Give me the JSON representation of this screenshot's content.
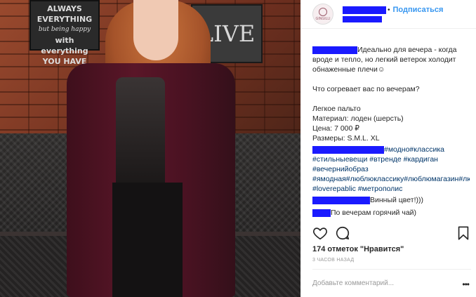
{
  "photo": {
    "sign_left": {
      "line1": "ALWAYS",
      "line2": "EVERYTHING",
      "line3": "but being happy",
      "line4": "with everything",
      "line5": "YOU HAVE"
    },
    "sign_right": "LIVE"
  },
  "header": {
    "avatar_text": "GINGILLI",
    "follow_label": "Подписаться",
    "bullet": "•"
  },
  "caption": {
    "line1": "Идеально для вечера - когда вроде и тепло, но легкий ветерок холодит обнаженные плечи☺",
    "question": "Что согревает вас по вечерам?",
    "item_name": "Легкое пальто",
    "material": "Материал: лоден (шерсть)",
    "price": "Цена: 7 000 ₽",
    "sizes": "Размеры: S.M.L. XL",
    "hashtags": "#модно#классика #стильныевещи #втренде #кардиган #вечернийобраз #ямодная#люблюклассику#люблюмагазин#люблюжизнь #loverepablic #метрополис",
    "comment1": "Винный цвет!)))",
    "comment2": "По вечерам горячий чай)"
  },
  "likes": "174 отметок \"Нравится\"",
  "time": "3 ЧАСОВ НАЗАД",
  "comment_placeholder": "Добавьте комментарий...",
  "more": "•••",
  "colors": {
    "redaction": "#1a1aff",
    "follow": "#3897f0",
    "hashtag": "#003569"
  }
}
